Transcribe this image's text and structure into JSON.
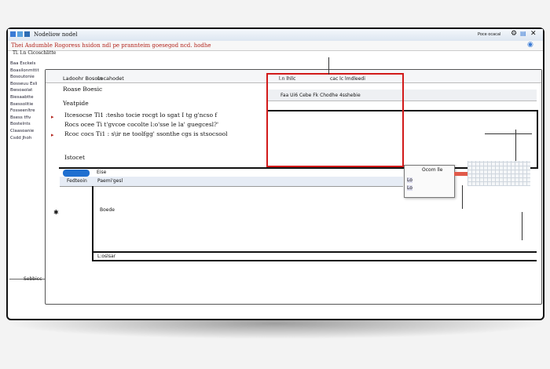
{
  "window": {
    "title": "Nodeliow nodel",
    "header_text": "Thei Asdumble Rogoress hsidon ndl pe prannteim goesegod ncd. hodhe",
    "subtitle": "Tl. l.n Cicoschlitte",
    "sidebar_items": [
      "Baa Esckels",
      "Boasilonmttit",
      "Bosoutonie",
      "Bosseuu Esli",
      "Bwsoaolat",
      "Biesaabtte",
      "Bsessolitie",
      "Fosseenltre",
      "Bsess tfiv",
      "Bostelnts",
      "Claasoanie",
      "Csdd Jhoh"
    ],
    "status_left": "Sebbicc",
    "right_controls": "Poce ocacal"
  },
  "dialog": {
    "header_left": "Ladoohr Bosoln",
    "header_mid": "Locahodet",
    "header_right_a": "l.n lhllc",
    "header_right_b": "cac lc lmdleedi",
    "toolbar_text": "Faa Ui6 Cebe Fk Chodhe 4sshebie",
    "field1": "Roase Boesic",
    "field2": "Yeatpide",
    "para": [
      "Itcesocse Tl1 :tesho tocie rocgt lo sgat I tg g'ncso f",
      "Rocs ocee Ti t'gvcoe cocolte l:o'sse le la' guegcesl?'",
      "Rcoc cocs Ti1 : s\\ir ne toolfgg' ssonthe cgs is stsocsool"
    ],
    "label_lower": "Istocet",
    "pill_label": "Fedteoin",
    "tab_label": "Eise",
    "panel_title": "Paemi'gesl",
    "panel_item": "Boede",
    "footer_label": "L:oslsar"
  },
  "popup": {
    "title": "Ocom lle",
    "row1": "Lo",
    "row2": "Lo"
  },
  "colors": {
    "highlight_red": "#d21a1a",
    "accent_blue": "#1f6fd0"
  },
  "icons": [
    "app-icon",
    "close-icon",
    "settings-icon",
    "search-icon",
    "pointer-icon",
    "cursor-icon"
  ]
}
